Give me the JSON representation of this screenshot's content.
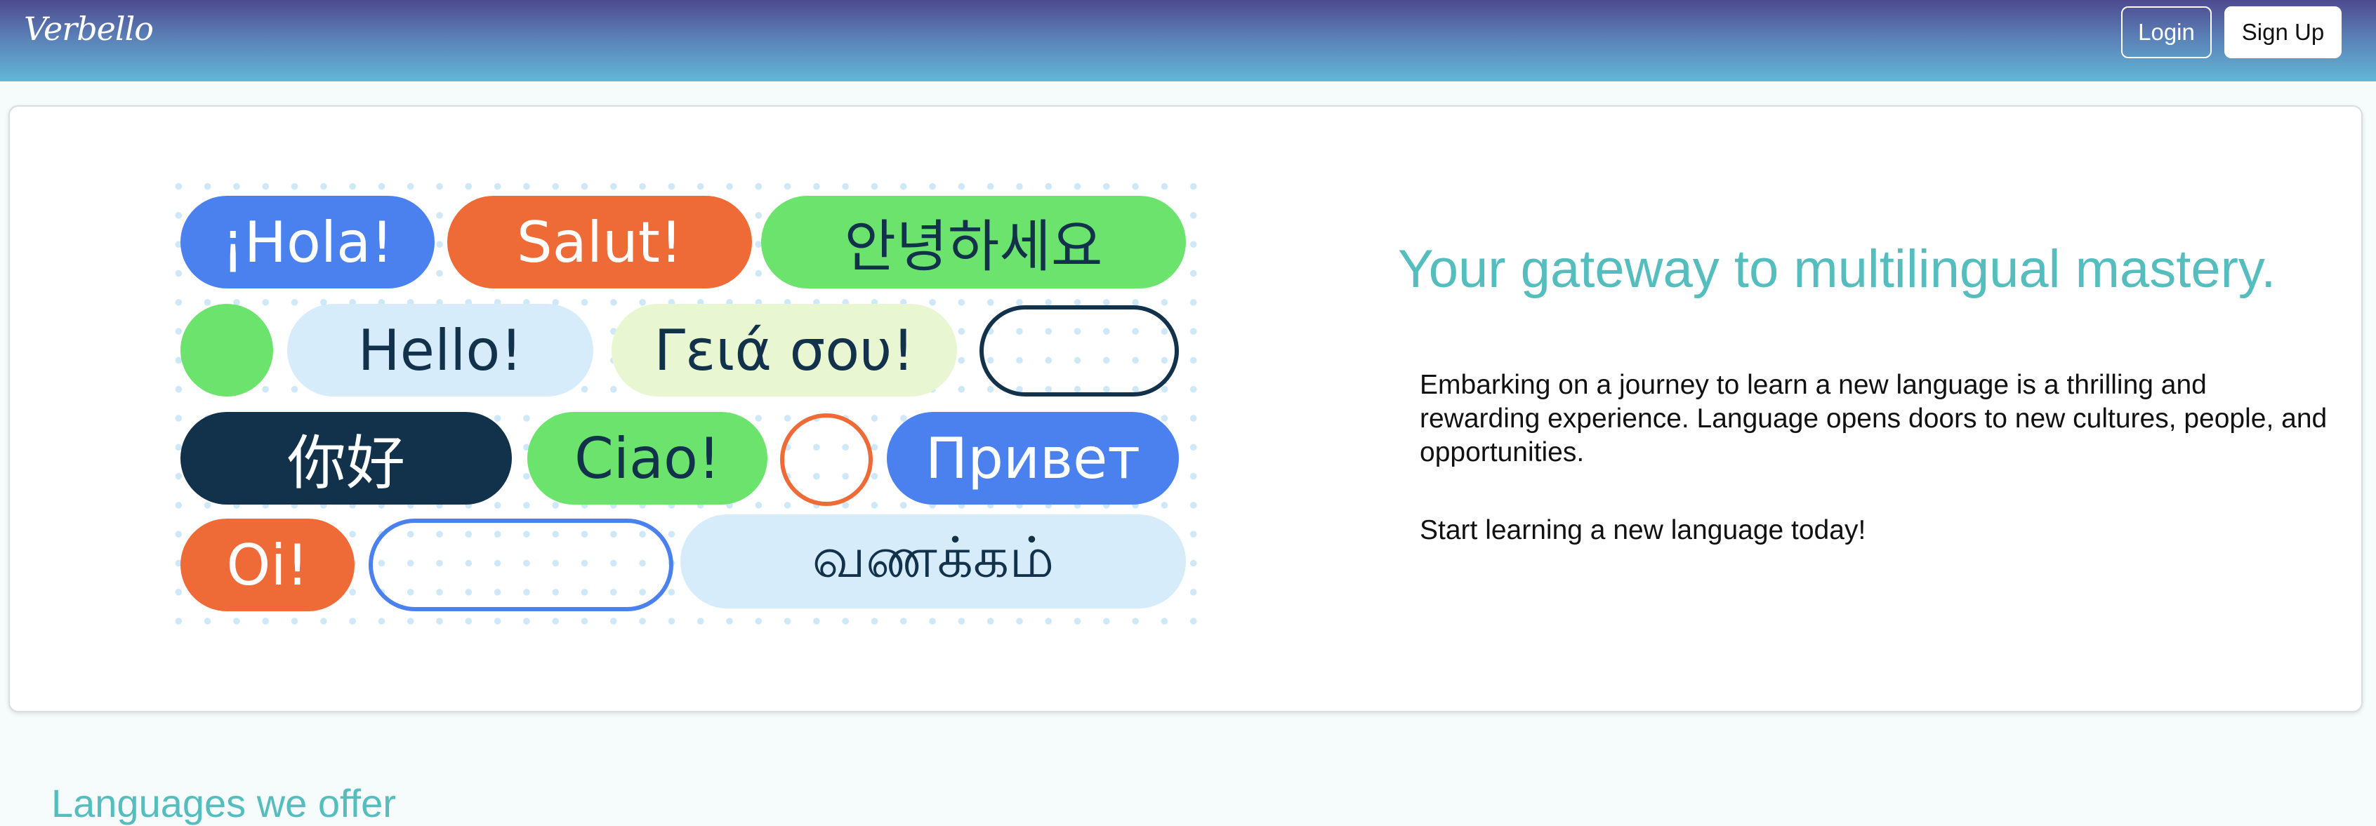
{
  "navbar": {
    "brand": "Verbello",
    "login_label": "Login",
    "signup_label": "Sign Up"
  },
  "hero": {
    "greetings": [
      "¡Hola!",
      "Salut!",
      "안녕하세요",
      "Hello!",
      "Γειά σου!",
      "你好",
      "Ciao!",
      "Привет",
      "Oi!",
      "வணக்கம்"
    ],
    "title": "Your gateway to multilingual mastery.",
    "description": "Embarking on a journey to learn a new language is a thrilling and rewarding experience. Language opens doors to new cultures, people, and opportunities.",
    "cta": "Start learning a new language today!"
  },
  "languages_section": {
    "heading": "Languages we offer"
  },
  "colors": {
    "accent_teal": "#55bdbd",
    "pill_blue": "#4a81ee",
    "pill_orange": "#ee6a37",
    "pill_green": "#6be36c",
    "pill_navy": "#12314a",
    "pill_light_blue": "#d6ecfb",
    "pill_cream": "#e9f6d2"
  }
}
